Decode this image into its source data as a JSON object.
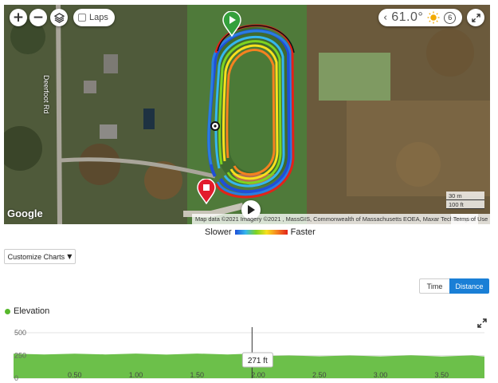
{
  "map": {
    "laps_label": "Laps",
    "zoom_in_icon": "plus-icon",
    "zoom_out_icon": "minus-icon",
    "layers_icon": "layers-icon",
    "weather": {
      "temperature": "61.0°",
      "condition_icon": "sun-icon",
      "wind_speed": "6"
    },
    "road_label": "Deerfoot Rd",
    "google_label": "Google",
    "attribution": "Map data ©2021 Imagery ©2021 , MassGIS, Commonwealth of Massachusetts EOEA, Maxar Technologies",
    "terms": "Terms of Use",
    "scale": [
      "30 m",
      "100 ft"
    ],
    "colors": {
      "start": "#34a03c",
      "end": "#e21b2c"
    }
  },
  "legend": {
    "slower": "Slower",
    "faster": "Faster"
  },
  "controls": {
    "customize_label": "Customize Charts",
    "time_label": "Time",
    "distance_label": "Distance",
    "active": "Distance"
  },
  "chart": {
    "title": "Elevation",
    "tooltip": "271 ft",
    "color": "#6cc04a"
  },
  "chart_data": {
    "type": "area",
    "title": "Elevation",
    "xlabel": "",
    "ylabel": "",
    "x_ticks": [
      "0.50",
      "1.00",
      "1.50",
      "2.00",
      "2.50",
      "3.00",
      "3.50"
    ],
    "y_ticks": [
      "0",
      "250",
      "500"
    ],
    "xlim": [
      0,
      3.85
    ],
    "ylim": [
      0,
      500
    ],
    "cursor_x": 1.95,
    "series": [
      {
        "x": [
          0,
          0.25,
          0.5,
          0.75,
          1.0,
          1.25,
          1.5,
          1.75,
          1.95,
          2.05,
          2.25,
          2.5,
          2.75,
          3.0,
          3.25,
          3.5,
          3.75,
          3.85
        ],
        "values": [
          270,
          271,
          270,
          272,
          271,
          270,
          271,
          272,
          271,
          255,
          250,
          252,
          250,
          251,
          252,
          250,
          251,
          250
        ]
      }
    ]
  }
}
